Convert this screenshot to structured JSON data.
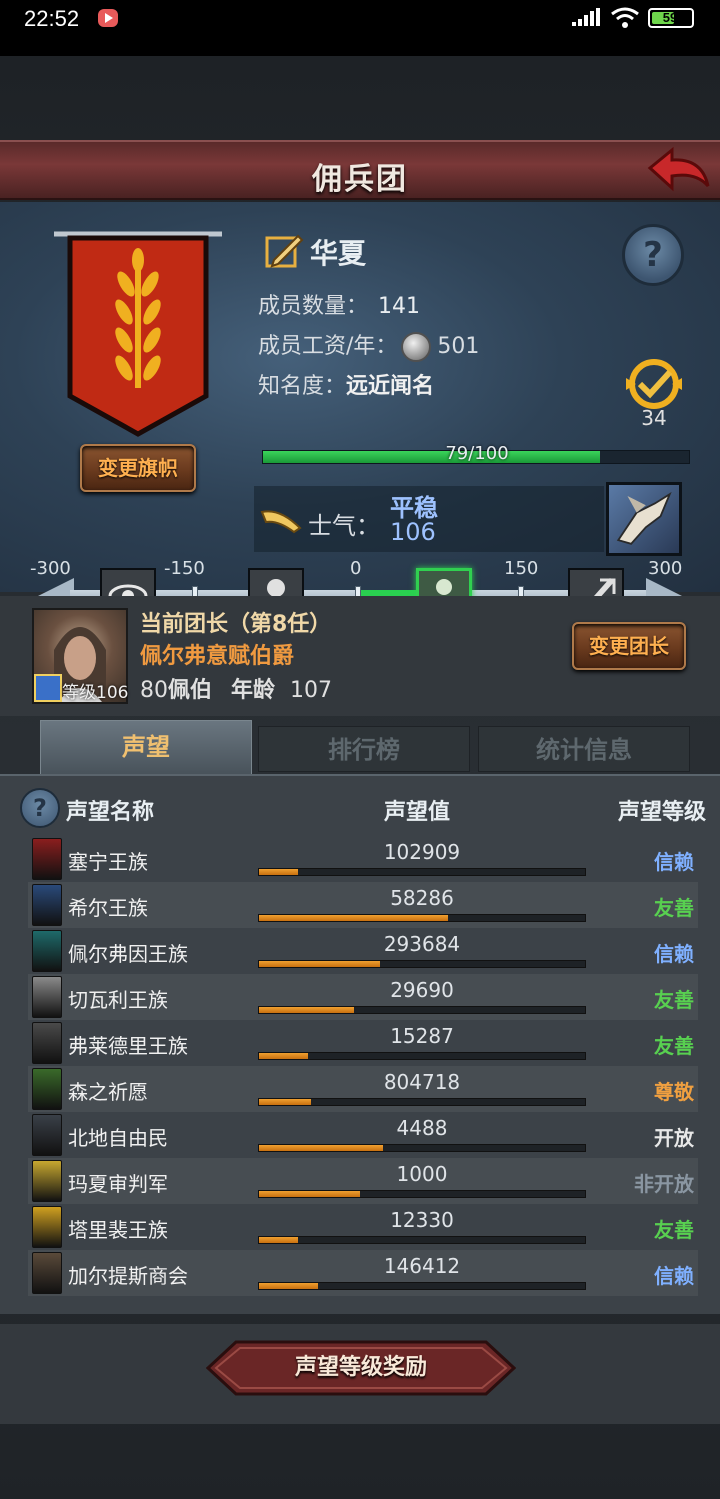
{
  "status_bar": {
    "time": "22:52",
    "battery": "59",
    "battery_level": 0.59
  },
  "title": "佣兵团",
  "company": {
    "name": "华夏",
    "members_label": "成员数量：",
    "members_value": "141",
    "salary_label": "成员工资/年：",
    "salary_value": "501",
    "fame_label": "知名度：",
    "fame_value": "远近闻名",
    "fame_progress_text": "79/100",
    "fame_progress": 0.79,
    "badge_value": "34",
    "change_flag_button": "变更旗帜"
  },
  "morale": {
    "label": "士气：",
    "state": "平稳",
    "value": "106",
    "scale": {
      "min": -300,
      "max": 300,
      "tick_labels": [
        "-300",
        "-150",
        "0",
        "150",
        "300"
      ],
      "current": 106
    }
  },
  "leader": {
    "title": "当前团长（第8任）",
    "name": "佩尔弗意赋伯爵",
    "level_text": "等级106",
    "rank_prefix": "80",
    "rank": "佩伯",
    "age_label": "年龄",
    "age_value": "107",
    "change_button": "变更团长"
  },
  "tabs": [
    {
      "label": "声望",
      "active": true
    },
    {
      "label": "排行榜",
      "active": false
    },
    {
      "label": "统计信息",
      "active": false
    }
  ],
  "reputation": {
    "headers": {
      "name": "声望名称",
      "value": "声望值",
      "level": "声望等级"
    },
    "rows": [
      {
        "name": "塞宁王族",
        "value": "102909",
        "level": "信赖",
        "level_color": "#7fb0ff",
        "progress": 0.12,
        "icon_color": "#8a1e1e",
        "icon": "banner-icon"
      },
      {
        "name": "希尔王族",
        "value": "58286",
        "level": "友善",
        "level_color": "#58d050",
        "progress": 0.58,
        "icon_color": "#2a4a7a",
        "icon": "banner-icon"
      },
      {
        "name": "佩尔弗因王族",
        "value": "293684",
        "level": "信赖",
        "level_color": "#7fb0ff",
        "progress": 0.37,
        "icon_color": "#1e6a6a",
        "icon": "banner-icon"
      },
      {
        "name": "切瓦利王族",
        "value": "29690",
        "level": "友善",
        "level_color": "#58d050",
        "progress": 0.29,
        "icon_color": "#8a8a8a",
        "icon": "banner-icon"
      },
      {
        "name": "弗莱德里王族",
        "value": "15287",
        "level": "友善",
        "level_color": "#58d050",
        "progress": 0.15,
        "icon_color": "#4a4a4a",
        "icon": "banner-icon"
      },
      {
        "name": "森之祈愿",
        "value": "804718",
        "level": "尊敬",
        "level_color": "#f0a040",
        "progress": 0.16,
        "icon_color": "#3a6a2a",
        "icon": "banner-icon"
      },
      {
        "name": "北地自由民",
        "value": "4488",
        "level": "开放",
        "level_color": "#e8e8e8",
        "progress": 0.38,
        "icon_color": "#3a4048",
        "icon": "banner-icon"
      },
      {
        "name": "玛夏审判军",
        "value": "1000",
        "level": "非开放",
        "level_color": "#8a96a2",
        "progress": 0.31,
        "icon_color": "#c8a830",
        "icon": "banner-icon"
      },
      {
        "name": "塔里裴王族",
        "value": "12330",
        "level": "友善",
        "level_color": "#58d050",
        "progress": 0.12,
        "icon_color": "#d0a020",
        "icon": "banner-icon"
      },
      {
        "name": "加尔提斯商会",
        "value": "146412",
        "level": "信赖",
        "level_color": "#7fb0ff",
        "progress": 0.18,
        "icon_color": "#5a4a3a",
        "icon": "banner-icon"
      }
    ]
  },
  "reward_button": "声望等级奖励"
}
